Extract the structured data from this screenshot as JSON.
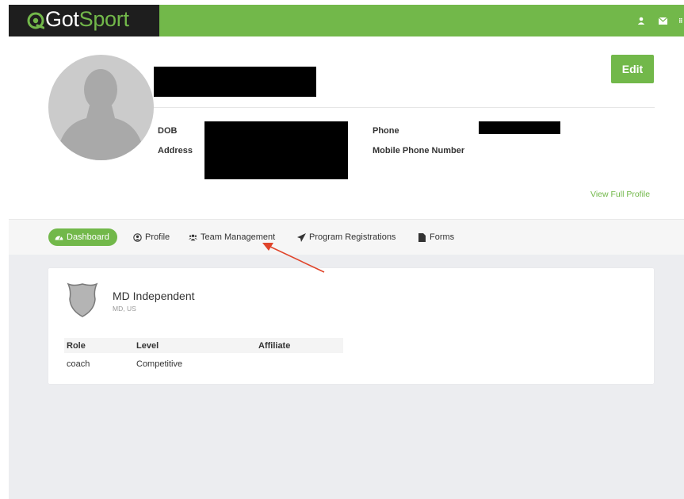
{
  "brand": {
    "logo_prefix": "Got",
    "logo_suffix": "Sport",
    "accent_color": "#72b84a",
    "dark_color": "#1e1e1e"
  },
  "header": {
    "icons": [
      "user-icon",
      "envelope-icon",
      "grid-menu-icon"
    ]
  },
  "profile": {
    "edit_label": "Edit",
    "dob_label": "DOB",
    "address_label": "Address",
    "phone_label": "Phone",
    "mobile_label": "Mobile Phone Number",
    "view_full_profile": "View Full Profile"
  },
  "tabs": [
    {
      "label": "Dashboard",
      "icon": "dashboard-icon",
      "active": true
    },
    {
      "label": "Profile",
      "icon": "user-circle-icon",
      "active": false
    },
    {
      "label": "Team Management",
      "icon": "users-icon",
      "active": false
    },
    {
      "label": "Program Registrations",
      "icon": "paper-plane-icon",
      "active": false
    },
    {
      "label": "Forms",
      "icon": "file-icon",
      "active": false
    }
  ],
  "club": {
    "name": "MD Independent",
    "location": "MD, US",
    "columns": [
      "Role",
      "Level",
      "Affiliate"
    ],
    "rows": [
      {
        "role": "coach",
        "level": "Competitive",
        "affiliate": ""
      }
    ]
  },
  "annotation": {
    "arrow_color": "#e0452b"
  }
}
